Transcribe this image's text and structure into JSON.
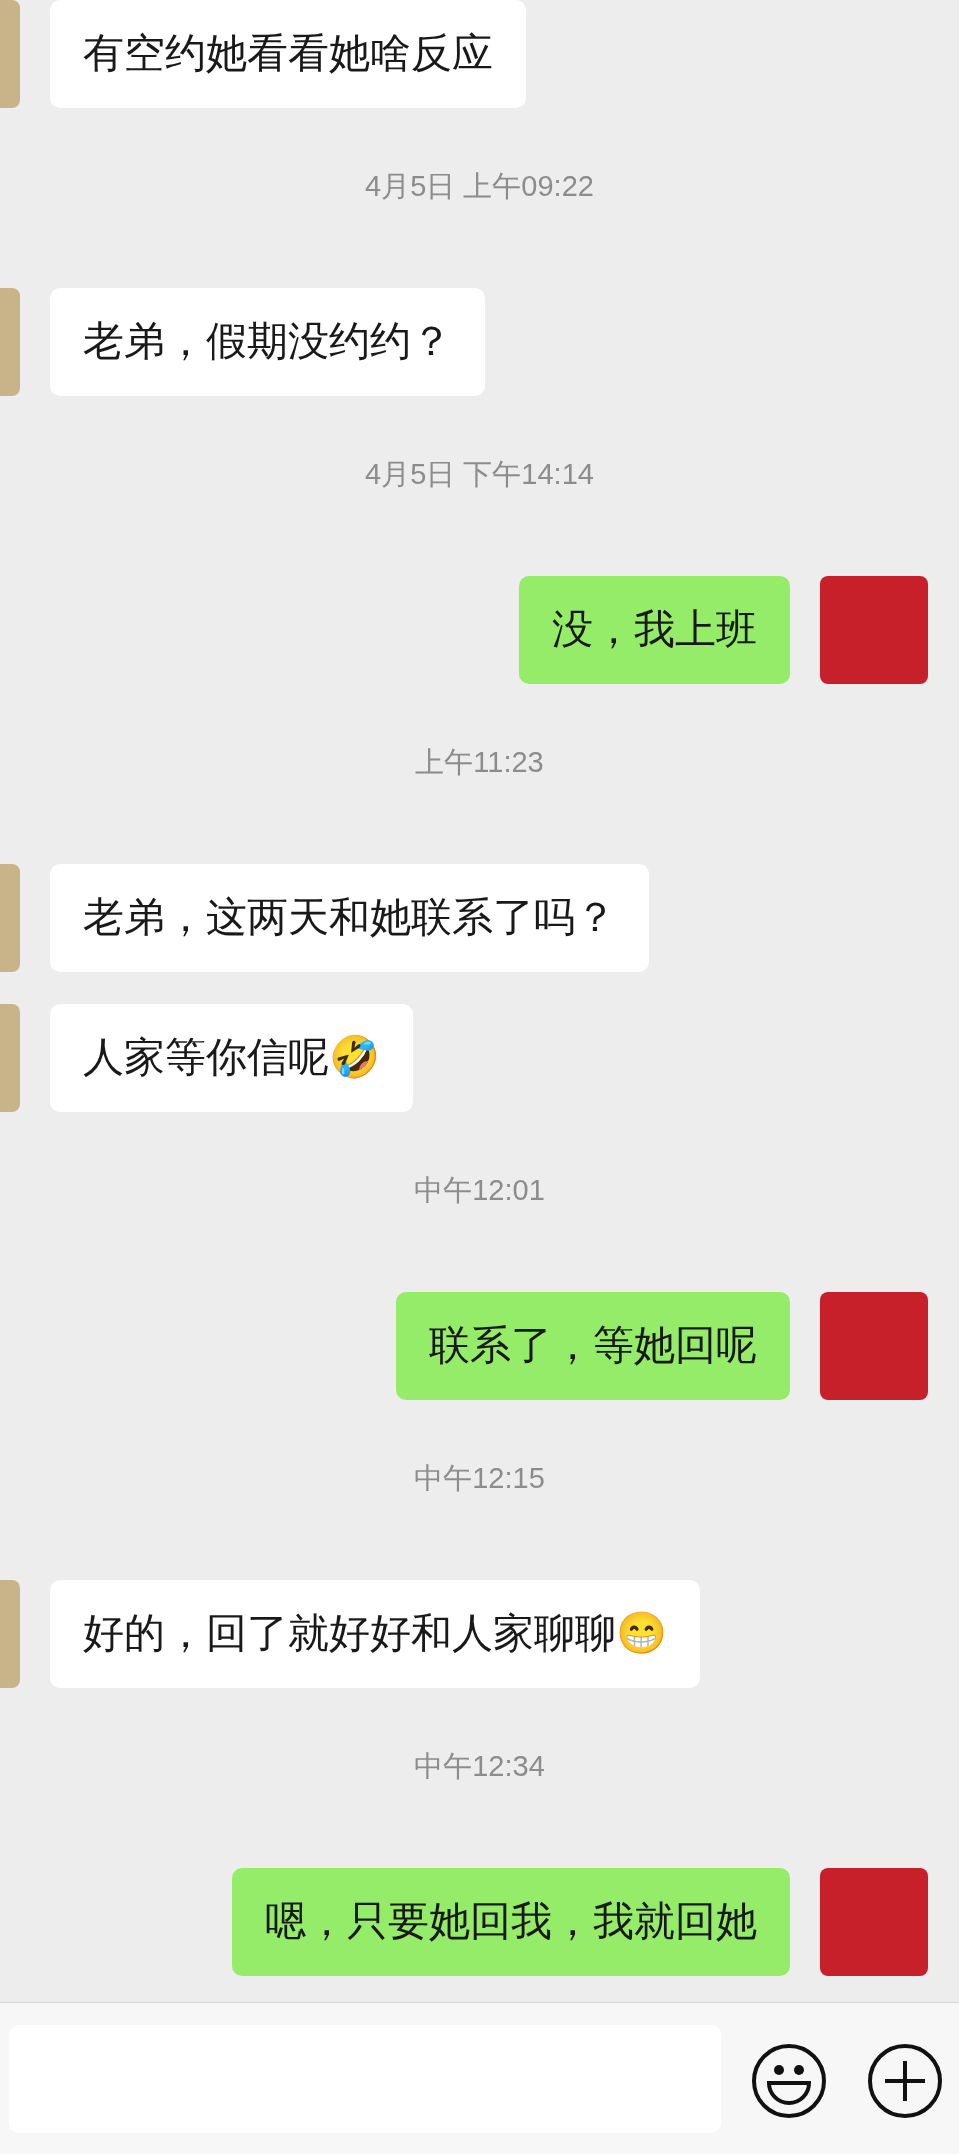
{
  "messages": [
    {
      "kind": "received",
      "text": "有空约她看看她啥反应"
    },
    {
      "kind": "time",
      "text": "4月5日 上午09:22"
    },
    {
      "kind": "received",
      "text": "老弟，假期没约约？"
    },
    {
      "kind": "time",
      "text": "4月5日 下午14:14"
    },
    {
      "kind": "sent",
      "text": "没，我上班"
    },
    {
      "kind": "time",
      "text": "上午11:23"
    },
    {
      "kind": "received",
      "text": "老弟，这两天和她联系了吗？"
    },
    {
      "kind": "received",
      "text": "人家等你信呢🤣"
    },
    {
      "kind": "time",
      "text": "中午12:01"
    },
    {
      "kind": "sent",
      "text": "联系了，等她回呢"
    },
    {
      "kind": "time",
      "text": "中午12:15"
    },
    {
      "kind": "received",
      "text": "好的，回了就好好和人家聊聊😁"
    },
    {
      "kind": "time",
      "text": "中午12:34"
    },
    {
      "kind": "sent",
      "text": "嗯，只要她回我，我就回她"
    }
  ]
}
